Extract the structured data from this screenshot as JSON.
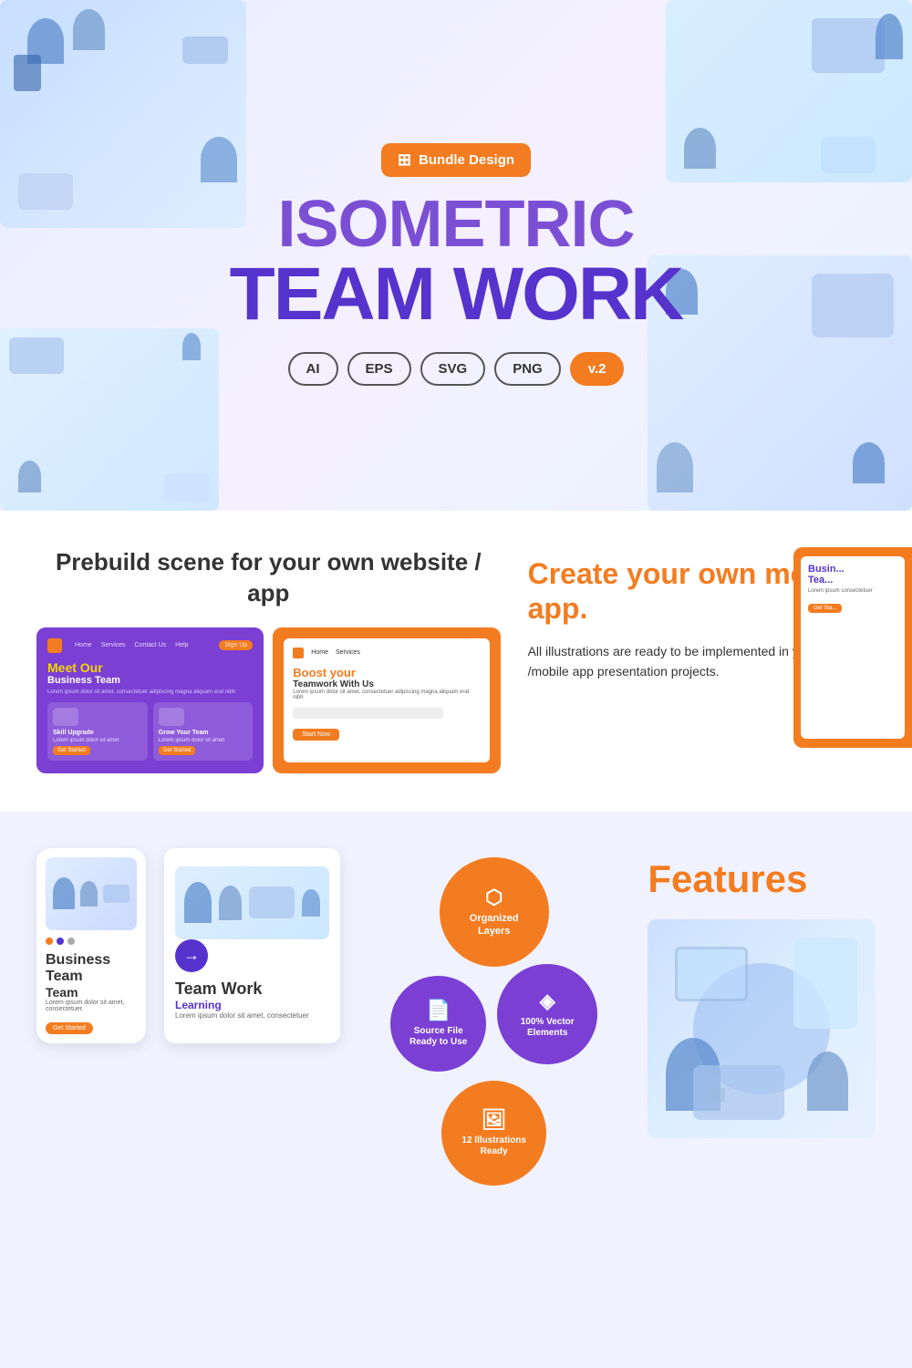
{
  "brand": {
    "name": "Bundle Design",
    "icon": "🏷"
  },
  "hero": {
    "line1": "ISOMETRIC",
    "line2": "TEAM WORK",
    "formats": [
      "AI",
      "EPS",
      "SVG",
      "PNG"
    ],
    "version": "v.2"
  },
  "prebuild": {
    "title_colored": "Prebuild scene for",
    "title_plain": "your own website / app",
    "website_mockup": {
      "nav_items": [
        "Home",
        "Services",
        "Contact Us",
        "Help"
      ],
      "nav_btn": "Sign Up",
      "title": "Meet Our",
      "subtitle": "Business Team",
      "desc": "Lorem ipsum dolor sit amet, consectetuer adipiscing magna aliquam erat nibh",
      "card1_title": "Skill Upgrade",
      "card1_desc": "Lorem ipsum dolor sit amet",
      "card2_title": "Grow Your Team",
      "card2_desc": "Lorem ipsum dolor sit amet"
    },
    "app_mockup": {
      "title": "Boost your",
      "subtitle": "Teamwork With Us",
      "desc": "Lorem ipsum dolor sit amet, consectetuer adipiscing magna aliquam erat nibh"
    }
  },
  "create": {
    "title": "Create your own mobile app.",
    "desc": "All illustrations are ready to be implemented in your website /mobile app presentation projects."
  },
  "phone_preview": {
    "title": "Business Team",
    "desc": "Lorem ipsum dolor sit amet, consectetuer.",
    "btn": "Get Started",
    "dots": [
      "#f47c20",
      "#5533cc",
      "#aaa"
    ]
  },
  "tablet_preview": {
    "title": "Team Work",
    "subtitle": "Learning",
    "desc": "Lorem ipsum dolor sit amet, consectetuer"
  },
  "features": {
    "section_title": "Features",
    "bubbles": [
      {
        "label": "Organized Layers",
        "icon": "⬡",
        "color": "orange",
        "size": "lg"
      },
      {
        "label": "100% Vector Elements",
        "icon": "◈",
        "color": "purple",
        "size": "md"
      },
      {
        "label": "Source File Ready to Use",
        "icon": "📄",
        "color": "purple",
        "size": "md"
      },
      {
        "label": "12 Illustrations Ready",
        "icon": "🖼",
        "color": "orange",
        "size": "md"
      }
    ]
  }
}
